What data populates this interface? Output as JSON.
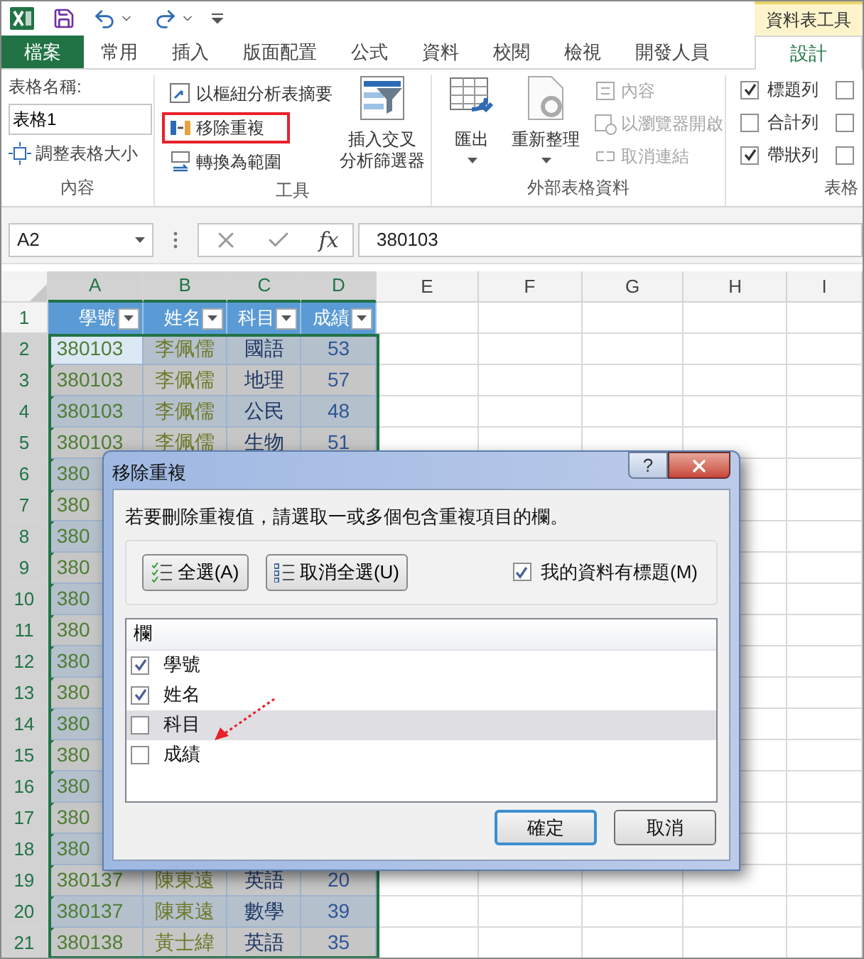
{
  "contextual_tab": "資料表工具",
  "tabs": [
    {
      "label": "檔案",
      "kind": "file",
      "selected": false
    },
    {
      "label": "常用",
      "kind": "tab",
      "selected": false
    },
    {
      "label": "插入",
      "kind": "tab",
      "selected": false
    },
    {
      "label": "版面配置",
      "kind": "tab",
      "selected": false
    },
    {
      "label": "公式",
      "kind": "tab",
      "selected": false
    },
    {
      "label": "資料",
      "kind": "tab",
      "selected": false
    },
    {
      "label": "校閱",
      "kind": "tab",
      "selected": false
    },
    {
      "label": "檢視",
      "kind": "tab",
      "selected": false
    },
    {
      "label": "開發人員",
      "kind": "tab",
      "selected": false
    },
    {
      "label": "設計",
      "kind": "context",
      "selected": true
    }
  ],
  "ribbon": {
    "properties": {
      "label": "表格名稱:",
      "value": "表格1",
      "resize": "調整表格大小",
      "caption": "內容"
    },
    "tools": {
      "commands": [
        {
          "label": "以樞紐分析表摘要",
          "highlighted": false
        },
        {
          "label": "移除重複",
          "highlighted": true
        },
        {
          "label": "轉換為範圍",
          "highlighted": false
        }
      ],
      "slicer": [
        "插入交叉",
        "分析篩選器"
      ],
      "caption": "工具"
    },
    "external": {
      "export": "匯出",
      "refresh": "重新整理",
      "commands": [
        {
          "label": "內容",
          "disabled": true
        },
        {
          "label": "以瀏覽器開啟",
          "disabled": true
        },
        {
          "label": "取消連結",
          "disabled": true
        }
      ],
      "caption": "外部表格資料"
    },
    "style_options": {
      "options": [
        {
          "label": "標題列",
          "checked": true
        },
        {
          "label": "合計列",
          "checked": false
        },
        {
          "label": "帶狀列",
          "checked": true
        }
      ],
      "more_options": [
        {
          "checked": false
        },
        {
          "checked": false
        },
        {
          "checked": false
        }
      ],
      "caption": "表格"
    }
  },
  "formula_bar": {
    "name_box": "A2",
    "function_label": "fx",
    "value": "380103"
  },
  "sheet": {
    "columns": [
      {
        "label": "A",
        "selected": true
      },
      {
        "label": "B",
        "selected": true
      },
      {
        "label": "C",
        "selected": true
      },
      {
        "label": "D",
        "selected": true
      },
      {
        "label": "E",
        "selected": false
      },
      {
        "label": "F",
        "selected": false
      },
      {
        "label": "G",
        "selected": false
      },
      {
        "label": "H",
        "selected": false
      },
      {
        "label": "I",
        "selected": false
      }
    ],
    "rows": [
      {
        "number": "1",
        "kind": "header",
        "selected": false,
        "active": false,
        "cells": [
          "學號",
          "姓名",
          "科目",
          "成績"
        ]
      },
      {
        "number": "2",
        "kind": "data",
        "selected": true,
        "active": true,
        "cells": [
          "380103",
          "李佩儒",
          "國語",
          "53"
        ]
      },
      {
        "number": "3",
        "kind": "data",
        "selected": true,
        "active": false,
        "cells": [
          "380103",
          "李佩儒",
          "地理",
          "57"
        ]
      },
      {
        "number": "4",
        "kind": "data",
        "selected": true,
        "active": false,
        "cells": [
          "380103",
          "李佩儒",
          "公民",
          "48"
        ]
      },
      {
        "number": "5",
        "kind": "data",
        "selected": true,
        "active": false,
        "cells": [
          "380103",
          "李佩儒",
          "生物",
          "51"
        ]
      },
      {
        "number": "6",
        "kind": "data",
        "selected": true,
        "active": false,
        "cells": [
          "380"
        ]
      },
      {
        "number": "7",
        "kind": "data",
        "selected": true,
        "active": false,
        "cells": [
          "380"
        ]
      },
      {
        "number": "8",
        "kind": "data",
        "selected": true,
        "active": false,
        "cells": [
          "380"
        ]
      },
      {
        "number": "9",
        "kind": "data",
        "selected": true,
        "active": false,
        "cells": [
          "380"
        ]
      },
      {
        "number": "10",
        "kind": "data",
        "selected": true,
        "active": false,
        "cells": [
          "380"
        ]
      },
      {
        "number": "11",
        "kind": "data",
        "selected": true,
        "active": false,
        "cells": [
          "380"
        ]
      },
      {
        "number": "12",
        "kind": "data",
        "selected": true,
        "active": false,
        "cells": [
          "380"
        ]
      },
      {
        "number": "13",
        "kind": "data",
        "selected": true,
        "active": false,
        "cells": [
          "380"
        ]
      },
      {
        "number": "14",
        "kind": "data",
        "selected": true,
        "active": false,
        "cells": [
          "380"
        ]
      },
      {
        "number": "15",
        "kind": "data",
        "selected": true,
        "active": false,
        "cells": [
          "380"
        ]
      },
      {
        "number": "16",
        "kind": "data",
        "selected": true,
        "active": false,
        "cells": [
          "380"
        ]
      },
      {
        "number": "17",
        "kind": "data",
        "selected": true,
        "active": false,
        "cells": [
          "380"
        ]
      },
      {
        "number": "18",
        "kind": "data",
        "selected": true,
        "active": false,
        "cells": [
          "380"
        ]
      },
      {
        "number": "19",
        "kind": "data",
        "selected": true,
        "active": false,
        "cells": [
          "380137",
          "陳東遠",
          "英語",
          "20"
        ]
      },
      {
        "number": "20",
        "kind": "data",
        "selected": true,
        "active": false,
        "cells": [
          "380137",
          "陳東遠",
          "數學",
          "39"
        ]
      },
      {
        "number": "21",
        "kind": "data",
        "selected": true,
        "active": false,
        "cells": [
          "380138",
          "黃士緯",
          "英語",
          "35"
        ]
      }
    ]
  },
  "dialog": {
    "title": "移除重複",
    "help_button": "?",
    "instruction": "若要刪除重複值，請選取一或多個包含重複項目的欄。",
    "select_all": "全選(A)",
    "unselect_all": "取消全選(U)",
    "has_headers": {
      "label": "我的資料有標題(M)",
      "checked": true
    },
    "list_header": "欄",
    "columns": [
      {
        "label": "學號",
        "checked": true,
        "selected": false
      },
      {
        "label": "姓名",
        "checked": true,
        "selected": false
      },
      {
        "label": "科目",
        "checked": false,
        "selected": true
      },
      {
        "label": "成績",
        "checked": false,
        "selected": false
      }
    ],
    "buttons": [
      {
        "label": "確定",
        "default": true
      },
      {
        "label": "取消",
        "default": false
      }
    ]
  }
}
